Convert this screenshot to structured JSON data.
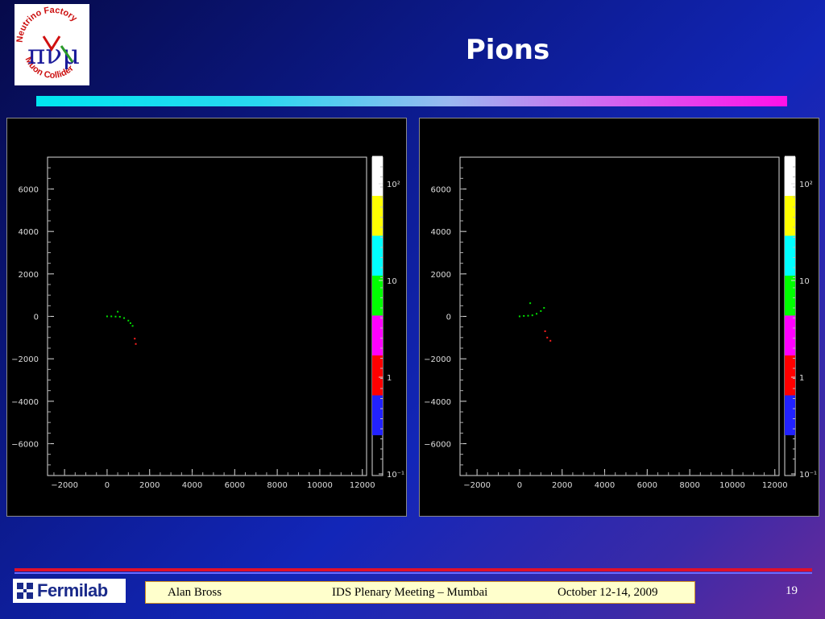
{
  "slide": {
    "title": "Pions",
    "page_number": "19"
  },
  "logo": {
    "top_text": "Neutrino Factory",
    "bottom_text": "Muon Collider",
    "symbols": "πνμ"
  },
  "footer": {
    "org": "Fermilab",
    "author": "Alan Bross",
    "meeting": "IDS Plenary Meeting – Mumbai",
    "date": "October 12-14, 2009"
  },
  "colors": {
    "title": "#ffffff",
    "track_green": "#00e000",
    "track_red": "#ff2020",
    "axis": "#ffffff",
    "palette": [
      "#2222ff",
      "#ff0000",
      "#ff00ff",
      "#00ff00",
      "#00ffff",
      "#ffff00",
      "#ffffff"
    ]
  },
  "chart_data": [
    {
      "type": "scatter",
      "xlim": [
        -2800,
        12200
      ],
      "ylim": [
        -7500,
        7500
      ],
      "xticks": [
        "-2000",
        "0",
        "2000",
        "4000",
        "6000",
        "8000",
        "10000",
        "12000"
      ],
      "yticks": [
        "6000",
        "4000",
        "2000",
        "0",
        "-2000",
        "-4000",
        "-6000"
      ],
      "colorbar": {
        "scale": "log",
        "labels": [
          "10²",
          "10",
          "1",
          "10⁻¹"
        ]
      },
      "series": [
        {
          "color": "green",
          "points": [
            [
              0,
              0
            ],
            [
              200,
              0
            ],
            [
              400,
              -10
            ],
            [
              600,
              -20
            ],
            [
              800,
              -80
            ],
            [
              1000,
              -200
            ],
            [
              1100,
              -320
            ],
            [
              1200,
              -450
            ],
            [
              500,
              220
            ]
          ]
        },
        {
          "color": "red",
          "points": [
            [
              1300,
              -1050
            ],
            [
              1350,
              -1300
            ]
          ]
        }
      ]
    },
    {
      "type": "scatter",
      "xlim": [
        -2800,
        12200
      ],
      "ylim": [
        -7500,
        7500
      ],
      "xticks": [
        "-2000",
        "0",
        "2000",
        "4000",
        "6000",
        "8000",
        "10000",
        "12000"
      ],
      "yticks": [
        "6000",
        "4000",
        "2000",
        "0",
        "-2000",
        "-4000",
        "-6000"
      ],
      "colorbar": {
        "scale": "log",
        "labels": [
          "10²",
          "10",
          "1",
          "10⁻¹"
        ]
      },
      "series": [
        {
          "color": "green",
          "points": [
            [
              0,
              0
            ],
            [
              200,
              20
            ],
            [
              400,
              30
            ],
            [
              600,
              50
            ],
            [
              800,
              120
            ],
            [
              1000,
              250
            ],
            [
              1150,
              400
            ],
            [
              500,
              620
            ]
          ]
        },
        {
          "color": "red",
          "points": [
            [
              1200,
              -700
            ],
            [
              1300,
              -1000
            ],
            [
              1450,
              -1150
            ]
          ]
        }
      ]
    }
  ]
}
